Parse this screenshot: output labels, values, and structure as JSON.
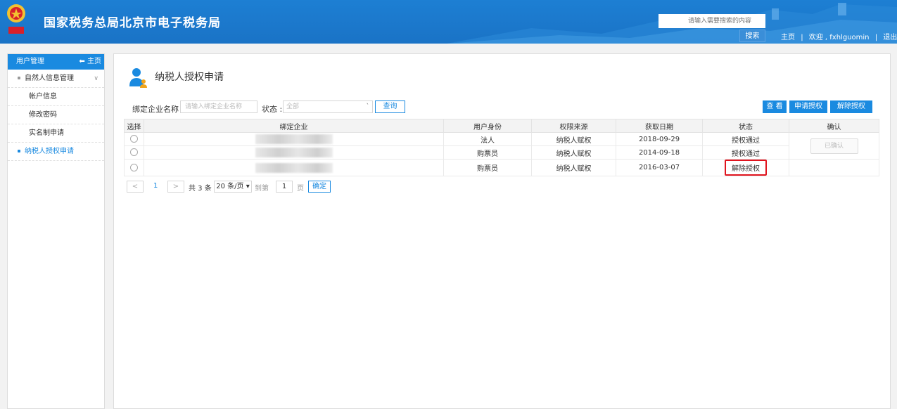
{
  "header": {
    "site_title": "国家税务总局北京市电子税务局",
    "search_placeholder": "请输入需要搜索的内容",
    "search_button": "搜索",
    "nav": {
      "home": "主页",
      "sep1": "|",
      "welcome": "欢迎 , fxhlguomin",
      "sep2": "|",
      "logout": "退出"
    }
  },
  "sidebar": {
    "title": "用户管理",
    "home_link": "主页",
    "group_label": "自然人信息管理",
    "items": [
      {
        "label": "帐户信息"
      },
      {
        "label": "修改密码"
      },
      {
        "label": "实名制申请"
      }
    ],
    "active_item": "纳税人授权申请"
  },
  "main": {
    "page_title": "纳税人授权申请",
    "filter": {
      "company_label": "绑定企业名称 :",
      "company_placeholder": "请输入绑定企业名称",
      "status_label": "状态 :",
      "status_value": "全部",
      "query_button": "查询"
    },
    "actions": {
      "view": "查 看",
      "apply": "申请授权",
      "revoke": "解除授权"
    },
    "table": {
      "headers": [
        "选择",
        "绑定企业",
        "用户身份",
        "权限来源",
        "获取日期",
        "状态",
        "确认"
      ],
      "rows": [
        {
          "identity": "法人",
          "source": "纳税人赋权",
          "date": "2018-09-29",
          "status": "授权通过"
        },
        {
          "identity": "购票员",
          "source": "纳税人赋权",
          "date": "2014-09-18",
          "status": "授权通过"
        },
        {
          "identity": "购票员",
          "source": "纳税人赋权",
          "date": "2016-03-07",
          "status": "解除授权"
        }
      ],
      "confirm_button": "已确认"
    },
    "pager": {
      "prev": "<",
      "page": "1",
      "next": ">",
      "total": "共 3 条",
      "page_size": "20 条/页",
      "goto_label": "到第",
      "goto_value": "1",
      "page_unit": "页",
      "confirm": "确定"
    }
  },
  "colors": {
    "header_blue": "#1a73c6",
    "accent": "#1a8ae0",
    "highlight_red": "#e0141e"
  }
}
